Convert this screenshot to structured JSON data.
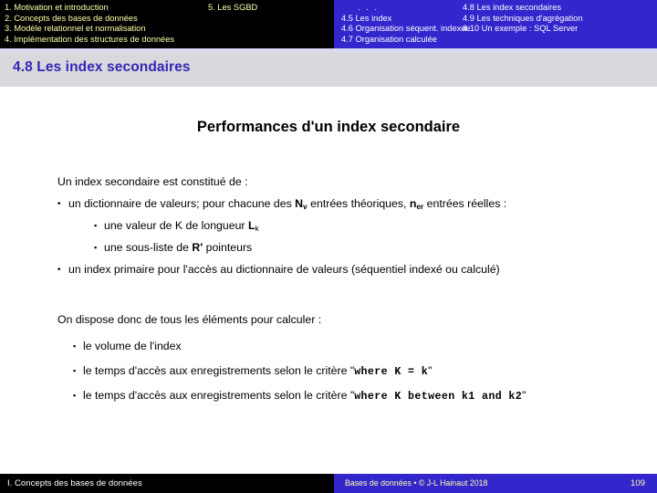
{
  "nav": {
    "chapters": [
      "1. Motivation et introduction",
      "2. Concepts des bases de données",
      "3. Modèle relationnel et normalisation",
      "4. Implémentation des structures de données"
    ],
    "chapter_right": "5. Les SGBD",
    "ellipsis": ". . .",
    "sections_col1": [
      "4.5 Les index",
      "4.6 Organisation séquent. indexée",
      "4.7 Organisation calculée"
    ],
    "sections_col2": [
      "4.8 Les index secondaires",
      "4.9 Les techniques d'agrégation",
      "4.10 Un exemple : SQL Server"
    ]
  },
  "section_title": "4.8 Les index secondaires",
  "slide": {
    "heading": "Performances d'un index secondaire",
    "intro": "Un index secondaire est constitué de :",
    "dict_part1": "un dictionnaire de valeurs; pour chacune des ",
    "dict_sym_n": "N",
    "dict_sym_n_sub": "v",
    "dict_part2": " entrées théoriques, ",
    "dict_sym_ner": "n",
    "dict_sym_ner_sub": "er",
    "dict_part3": " entrées réelles :",
    "kval_part1": "une valeur de K de longueur ",
    "kval_sym": "L",
    "kval_sym_sub": "k",
    "sublist_part1": "une sous-liste de ",
    "sublist_sym": "R'",
    "sublist_part2": " pointeurs",
    "primary": "un index primaire pour l'accès au dictionnaire de valeurs (séquentiel indexé ou calculé)",
    "dispose": "On dispose donc de tous les éléments pour calculer :",
    "volume": "le volume de l'index",
    "acces1_prefix": "le temps d'accès aux enregistrements selon le critère \"",
    "acces1_code": "where K = k",
    "acces1_suffix": "\"",
    "acces2_prefix": "le temps d'accès aux enregistrements selon le critère \"",
    "acces2_code": "where K between k1 and k2",
    "acces2_suffix": "\""
  },
  "footer": {
    "chapter": "I. Concepts des bases de données",
    "credit": "Bases de données • © J-L Hainaut 2018",
    "page": "109"
  },
  "colors": {
    "blue": "#3226cc",
    "black": "#000000",
    "nav_yellow": "#ffffaa",
    "title_bar": "#d9d9dd",
    "title_text": "#3326b5"
  }
}
